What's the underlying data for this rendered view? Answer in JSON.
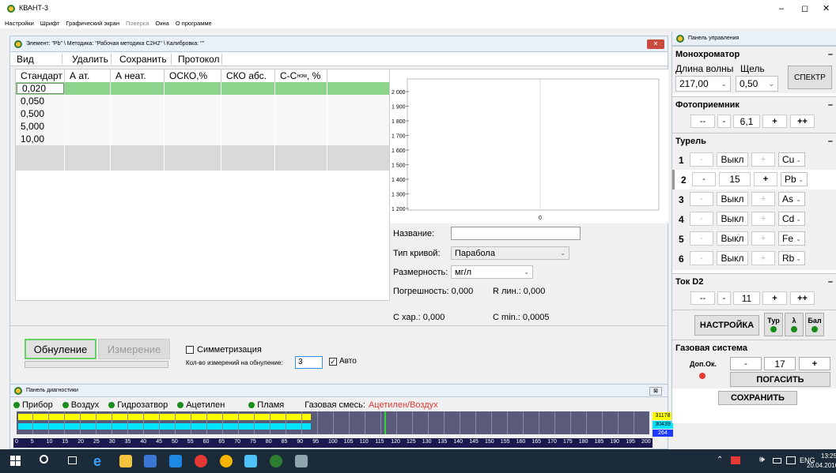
{
  "app": {
    "title": "КВАНТ-3",
    "win_min": "–",
    "win_max": "◻",
    "win_close": "✕"
  },
  "menu": [
    {
      "label": "Настройки",
      "enabled": true
    },
    {
      "label": "Шрифт",
      "enabled": true
    },
    {
      "label": "Графический экран",
      "enabled": true
    },
    {
      "label": "Поверка",
      "enabled": false
    },
    {
      "label": "Окна",
      "enabled": true
    },
    {
      "label": "О программе",
      "enabled": true
    }
  ],
  "calib_window": {
    "title": "Элемент: \"Pb\" \\ Методика: \"Рабочая методика C2H2\" \\ Калибровка: \"\"",
    "toolbar": {
      "view": "Вид",
      "delete": "Удалить",
      "save": "Сохранить",
      "protocol": "Протокол"
    },
    "columns": [
      "Стандарт",
      "А ат.",
      "А неат.",
      "ОСКО,%",
      "СКО абс.",
      "С-С"
    ],
    "col_sub": "ном",
    "col_tail": ", %",
    "rows": [
      "0,020",
      "0,050",
      "0,500",
      "5,000",
      "10,00",
      "",
      ""
    ],
    "graph": {
      "y_ticks": [
        "2 000",
        "1 900",
        "1 800",
        "1 700",
        "1 600",
        "1 500",
        "1 400",
        "1 300",
        "1 200"
      ],
      "x_tick": "0"
    },
    "form": {
      "name_label": "Название:",
      "name_value": "",
      "curve_label": "Тип кривой:",
      "curve_value": "Парабола",
      "unit_label": "Размерность:",
      "unit_value": "мг/л",
      "error_text": "Погрешность: 0,000",
      "rlin_text": "R лин.: 0,000",
      "chr_text": "C хар.: 0,000",
      "cmin_text": "C min.: 0,0005"
    },
    "zero_button": "Обнуление",
    "measure_button": "Измерение",
    "symmetry_label": "Симметризация",
    "symmetry_checked": false,
    "count_label": "Кол-во измерений на обнуление:",
    "count_value": "3",
    "auto_label": "Авто",
    "auto_checked": true
  },
  "diag": {
    "title": "Панель диагностики",
    "indicators": [
      "Прибор",
      "Воздух",
      "Гидрозатвор",
      "Ацетилен",
      "Пламя"
    ],
    "gas_label": "Газовая смесь:",
    "gas_value": "Ацетилен/Воздух",
    "scale": [
      "0",
      "5",
      "10",
      "15",
      "20",
      "25",
      "30",
      "35",
      "40",
      "45",
      "50",
      "55",
      "60",
      "65",
      "70",
      "75",
      "80",
      "85",
      "90",
      "95",
      "100",
      "105",
      "110",
      "115",
      "120",
      "125",
      "130",
      "135",
      "140",
      "145",
      "150",
      "155",
      "160",
      "165",
      "170",
      "175",
      "180",
      "185",
      "190",
      "195",
      "200"
    ],
    "values": [
      "31178",
      "30439",
      "264"
    ],
    "yellow_fraction": 0.465,
    "cyan_fraction": 0.465,
    "colors": {
      "yellow": "#ffff00",
      "cyan": "#00e5ff",
      "blue": "#1e3cff"
    }
  },
  "control": {
    "title": "Панель управления",
    "mono": {
      "header": "Монохроматор",
      "wl_label": "Длина волны",
      "slit_label": "Щель",
      "wl_value": "217,00",
      "slit_value": "0,50",
      "spectrum": "СПЕКТР"
    },
    "photo": {
      "header": "Фотоприемник",
      "dec2": "--",
      "dec1": "-",
      "value": "6,1",
      "inc1": "+",
      "inc2": "++"
    },
    "turret": {
      "header": "Турель",
      "rows": [
        {
          "num": "1",
          "value": "Выкл",
          "el": "Cu",
          "active": false
        },
        {
          "num": "2",
          "value": "15",
          "el": "Pb",
          "active": true
        },
        {
          "num": "3",
          "value": "Выкл",
          "el": "As",
          "active": false
        },
        {
          "num": "4",
          "value": "Выкл",
          "el": "Cd",
          "active": false
        },
        {
          "num": "5",
          "value": "Выкл",
          "el": "Fe",
          "active": false
        },
        {
          "num": "6",
          "value": "Выкл",
          "el": "Rb",
          "active": false
        }
      ],
      "minus": "-",
      "plus": "+"
    },
    "d2": {
      "header": "Ток D2",
      "dec2": "--",
      "dec1": "-",
      "value": "11",
      "inc1": "+",
      "inc2": "++"
    },
    "settings": "НАСТРОЙКА",
    "flags": [
      "Тур",
      "λ",
      "Бал"
    ],
    "gas": {
      "header": "Газовая система",
      "extra_label": "Доп.Ок.",
      "minus": "-",
      "value": "17",
      "plus": "+",
      "extinguish": "ПОГАСИТЬ"
    },
    "save": "СОХРАНИТЬ",
    "collapse": "–"
  },
  "taskbar": {
    "lang": "ENG",
    "time": "13:25",
    "date": "20.04.2016"
  }
}
